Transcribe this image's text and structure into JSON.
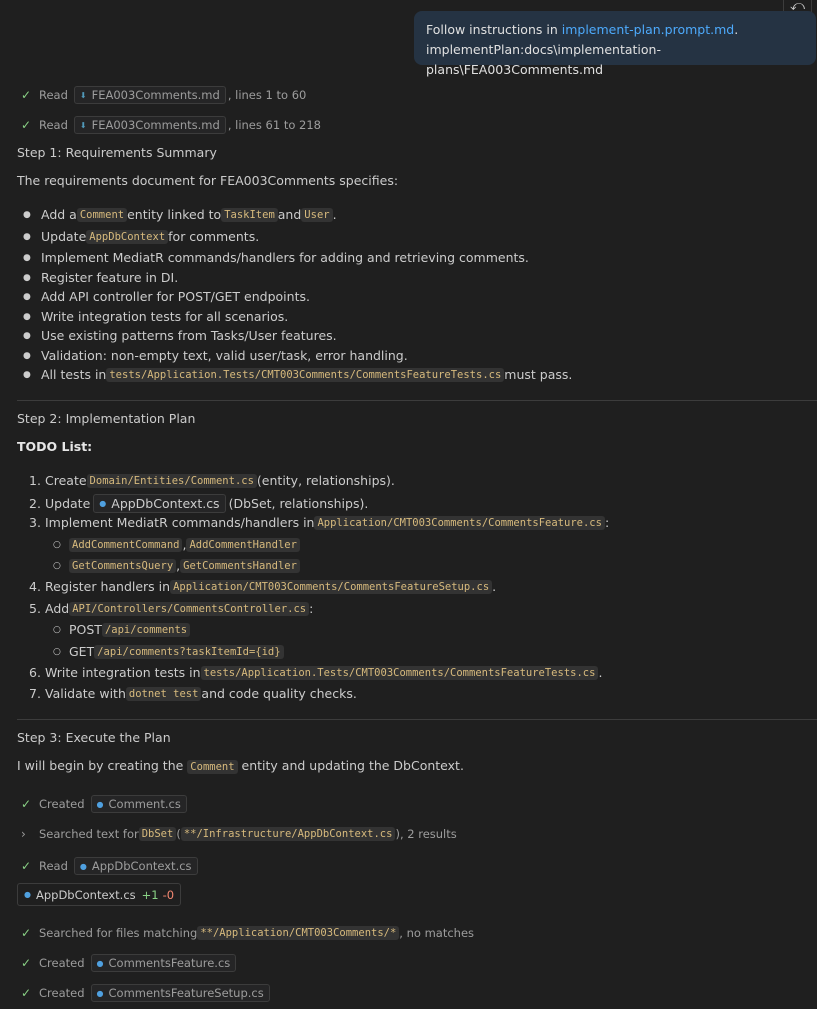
{
  "header": {
    "undo_icon": "undo-icon",
    "request_prefix": "Follow instructions in ",
    "request_link": "implement-plan.prompt.md",
    "request_suffix": ".",
    "request_line2": "implementPlan:docs\\implementation-plans\\FEA003Comments.md"
  },
  "tools_top": [
    {
      "action": "Read",
      "file": "FEA003Comments.md",
      "detail": ", lines 1 to 60"
    },
    {
      "action": "Read",
      "file": "FEA003Comments.md",
      "detail": ", lines 61 to 218"
    }
  ],
  "step1": {
    "heading": "Step 1: Requirements Summary",
    "intro": "The requirements document for FEA003Comments specifies:",
    "b1": {
      "p1": "Add a ",
      "c1": "Comment",
      "p2": " entity linked to ",
      "c2": "TaskItem",
      "p3": " and ",
      "c3": "User",
      "p4": "."
    },
    "b2": {
      "p1": "Update ",
      "c1": "AppDbContext",
      "p2": " for comments."
    },
    "b3": "Implement MediatR commands/handlers for adding and retrieving comments.",
    "b4": "Register feature in DI.",
    "b5": "Add API controller for POST/GET endpoints.",
    "b6": "Write integration tests for all scenarios.",
    "b7": "Use existing patterns from Tasks/User features.",
    "b8": "Validation: non-empty text, valid user/task, error handling.",
    "b9": {
      "p1": "All tests in ",
      "c1": "tests/Application.Tests/CMT003Comments/CommentsFeatureTests.cs",
      "p2": " must pass."
    }
  },
  "step2": {
    "heading": "Step 2: Implementation Plan",
    "todo": "TODO List:",
    "i1": {
      "n": "1.",
      "p1": "Create ",
      "c1": "Domain/Entities/Comment.cs",
      "p2": " (entity, relationships)."
    },
    "i2": {
      "n": "2.",
      "p1": "Update",
      "f1": "AppDbContext.cs",
      "p2": " (DbSet, relationships)."
    },
    "i3": {
      "n": "3.",
      "p1": "Implement MediatR commands/handlers in ",
      "c1": "Application/CMT003Comments/CommentsFeature.cs",
      "p2": ":"
    },
    "i3a": {
      "c1": "AddCommentCommand",
      "p1": ", ",
      "c2": "AddCommentHandler"
    },
    "i3b": {
      "c1": "GetCommentsQuery",
      "p1": ", ",
      "c2": "GetCommentsHandler"
    },
    "i4": {
      "n": "4.",
      "p1": "Register handlers in ",
      "c1": "Application/CMT003Comments/CommentsFeatureSetup.cs",
      "p2": "."
    },
    "i5": {
      "n": "5.",
      "p1": "Add ",
      "c1": "API/Controllers/CommentsController.cs",
      "p2": ":"
    },
    "i5a": {
      "p1": "POST ",
      "c1": "/api/comments"
    },
    "i5b": {
      "p1": "GET ",
      "c1": "/api/comments?taskItemId={id}"
    },
    "i6": {
      "n": "6.",
      "p1": "Write integration tests in ",
      "c1": "tests/Application.Tests/CMT003Comments/CommentsFeatureTests.cs",
      "p2": "."
    },
    "i7": {
      "n": "7.",
      "p1": "Validate with ",
      "c1": "dotnet test",
      "p2": " and code quality checks."
    }
  },
  "step3": {
    "heading": "Step 3: Execute the Plan",
    "intro": {
      "p1": "I will begin by creating the ",
      "c1": "Comment",
      "p2": " entity and updating the DbContext."
    }
  },
  "tools_bottom": {
    "t1": {
      "action": "Created",
      "file": "Comment.cs"
    },
    "t2": {
      "action": "Searched text for ",
      "c1": "DbSet",
      "p1": " (",
      "c2": "**/Infrastructure/AppDbContext.cs",
      "p2": "), 2 results"
    },
    "t3": {
      "action": "Read",
      "file": "AppDbContext.cs"
    },
    "diff": {
      "file": "AppDbContext.cs",
      "plus": "+1",
      "minus": "-0"
    },
    "t4": {
      "action": "Searched for files matching ",
      "c1": "**/Application/CMT003Comments/*",
      "p1": ", no matches"
    },
    "t5": {
      "action": "Created",
      "file": "CommentsFeature.cs"
    },
    "t6": {
      "action": "Created",
      "file": "CommentsFeatureSetup.cs"
    }
  }
}
